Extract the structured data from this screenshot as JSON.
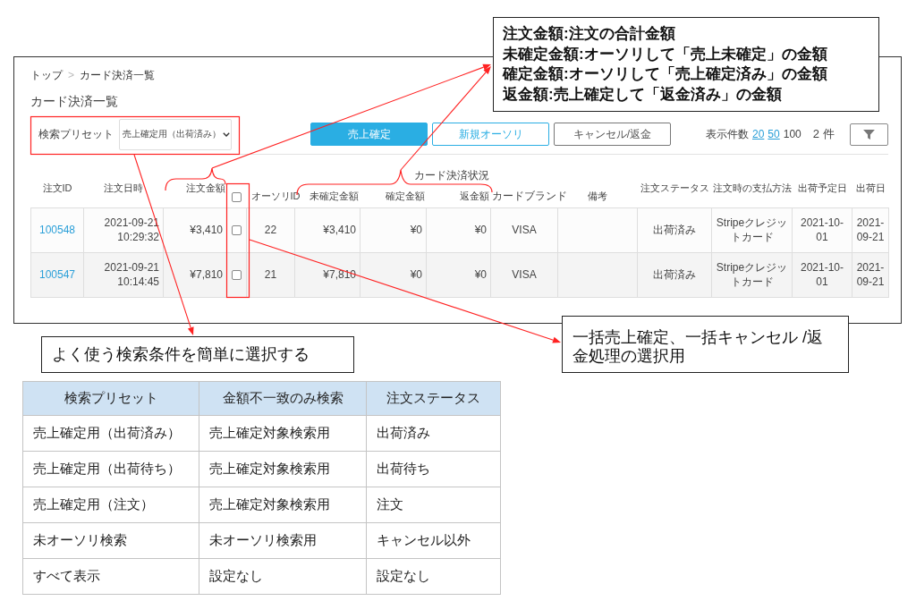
{
  "screenshot": {
    "breadcrumb": {
      "items": [
        "トップ",
        "カード決済一覧"
      ],
      "separator": ">"
    },
    "title": "カード決済一覧",
    "search_preset": {
      "label": "検索プリセット",
      "value": "売上確定用（出荷済み）"
    },
    "buttons": [
      {
        "label": "売上確定",
        "kind": "primary"
      },
      {
        "label": "新規オーソリ",
        "kind": "outline"
      },
      {
        "label": "キャンセル/返金",
        "kind": "plain"
      }
    ],
    "page_size": {
      "label": "表示件数",
      "options": [
        {
          "label": "20",
          "selected": false
        },
        {
          "label": "50",
          "selected": false
        },
        {
          "label": "100",
          "selected": true
        }
      ]
    },
    "result_count": "2 件",
    "table": {
      "columns": [
        {
          "kind": "text",
          "label": "注文ID"
        },
        {
          "kind": "text",
          "label": "注文日時"
        },
        {
          "kind": "text",
          "label": "注文金額"
        },
        {
          "kind": "group",
          "label": "カード決済状況",
          "children": [
            {
              "kind": "checkbox",
              "checked": false
            },
            {
              "kind": "text",
              "label": "オーソリID"
            },
            {
              "kind": "text",
              "label": "未確定金額"
            },
            {
              "kind": "text",
              "label": "確定金額"
            },
            {
              "kind": "text",
              "label": "返金額"
            },
            {
              "kind": "text",
              "label": "カードブランド"
            },
            {
              "kind": "text",
              "label": "備考"
            }
          ]
        },
        {
          "kind": "text",
          "label": "注文ステータス"
        },
        {
          "kind": "text",
          "label": "注文時の支払方法"
        },
        {
          "kind": "text",
          "label": "出荷予定日"
        },
        {
          "kind": "text",
          "label": "出荷日"
        }
      ],
      "rows": [
        {
          "order_id": "100548",
          "ordered_at": "2021-09-21 10:29:32",
          "order_amount": "¥3,410",
          "checked": false,
          "authorization_id": "22",
          "unconfirmed_amount": "¥3,410",
          "confirmed_amount": "¥0",
          "refunded_amount": "¥0",
          "card_brand": "VISA",
          "order_status": "出荷済み",
          "payment_method": "Stripeクレジットカード",
          "planned_ship_date": "2021-10-01",
          "ship_date": "2021-09-21"
        },
        {
          "order_id": "100547",
          "ordered_at": "2021-09-21 10:14:45",
          "order_amount": "¥7,810",
          "checked": false,
          "authorization_id": "21",
          "unconfirmed_amount": "¥7,810",
          "confirmed_amount": "¥0",
          "refunded_amount": "¥0",
          "card_brand": "VISA",
          "order_status": "出荷済み",
          "payment_method": "Stripeクレジットカード",
          "planned_ship_date": "2021-10-01",
          "ship_date": "2021-09-21"
        }
      ]
    }
  },
  "annotations": {
    "amount_legend": [
      "注文金額:注文の合計金額",
      "未確定金額:オーソリして「売上未確定」の金額",
      "確定金額:オーソリして「売上確定済み」の金額",
      "返金額:売上確定して「返金済み」の金額"
    ],
    "bulk_note": "一括売上確定、一括キャンセル /返金処理の選択用",
    "preset_note": "よく使う検索条件を簡単に選択する"
  },
  "preset_table": {
    "columns": [
      "検索プリセット",
      "金額不一致のみ検索",
      "注文ステータス"
    ],
    "rows": [
      [
        "売上確定用（出荷済み）",
        "売上確定対象検索用",
        "出荷済み"
      ],
      [
        "売上確定用（出荷待ち）",
        "売上確定対象検索用",
        "出荷待ち"
      ],
      [
        "売上確定用（注文）",
        "売上確定対象検索用",
        "注文"
      ],
      [
        "未オーソリ検索",
        "未オーソリ検索用",
        "キャンセル以外"
      ],
      [
        "すべて表示",
        "設定なし",
        "設定なし"
      ]
    ]
  }
}
